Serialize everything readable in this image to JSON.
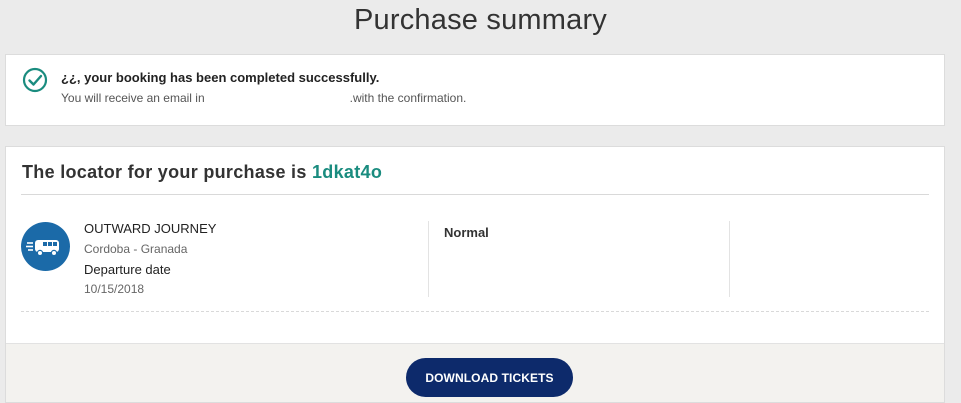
{
  "page": {
    "title": "Purchase summary"
  },
  "notice": {
    "icon": "check-circle-icon",
    "icon_color": "#1a8c7f",
    "title": "¿¿, your booking has been completed successfully.",
    "sub_prefix": "You will receive an email in",
    "sub_suffix": ".with the confirmation."
  },
  "booking": {
    "locator_prefix": "The locator for your purchase is",
    "locator_code": "1dkat4o",
    "locator_color": "#1a8c7f",
    "journey": {
      "icon": "bus-icon",
      "icon_bg": "#1b6aa8",
      "label": "OUTWARD JOURNEY",
      "route": "Cordoba - Granada",
      "departure_label": "Departure date",
      "departure_date": "10/15/2018",
      "fare": "Normal"
    }
  },
  "actions": {
    "download_label": "DOWNLOAD TICKETS",
    "download_color": "#0d2a6b"
  }
}
